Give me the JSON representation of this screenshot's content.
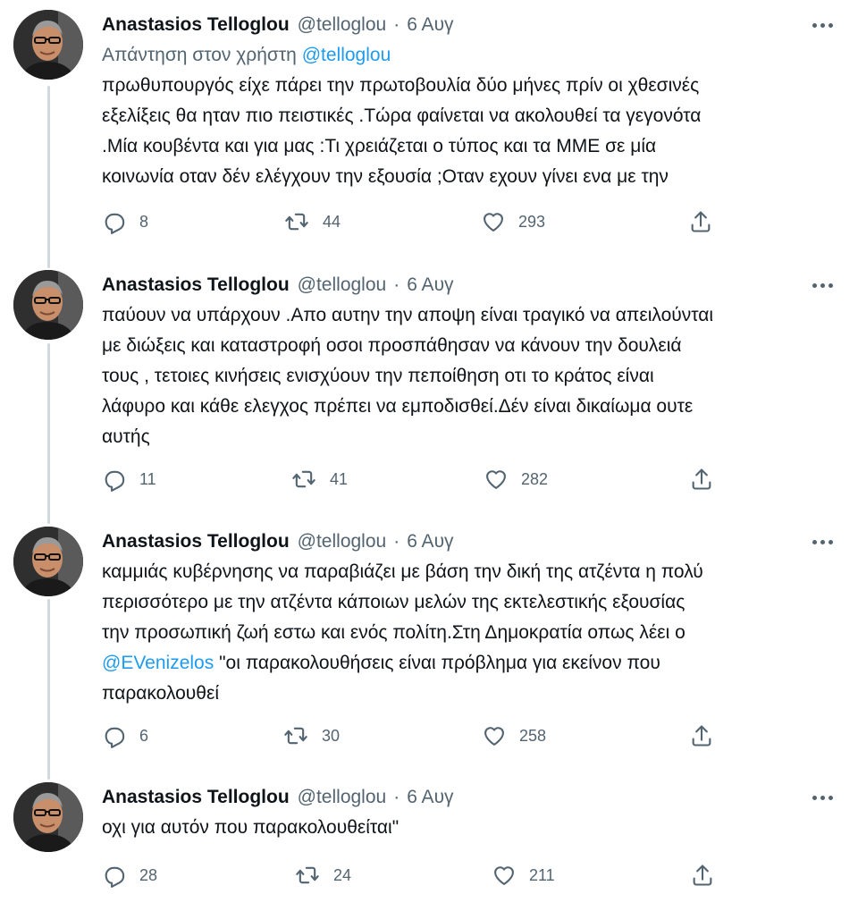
{
  "tweets": [
    {
      "author": "Anastasios Telloglou",
      "handle": "@telloglou",
      "separator": "·",
      "time": "6 Αυγ",
      "reply_prefix": "Απάντηση στον χρήστη",
      "reply_to": "@telloglou",
      "lines": [
        "πρωθυπουργός είχε πάρει την πρωτοβουλία δύο μήνες πρίν οι χθεσινές",
        "εξελίξεις θα ηταν πιο πειστικές .Τώρα φαίνεται να ακολουθεί τα γεγονότα",
        ".Μία κουβέντα και για μας :Τι χρειάζεται ο τύπος και τα ΜΜΕ σε μία",
        "κοινωνία οταν δέν ελέγχουν την εξουσία ;Οταν εχουν γίνει ενα με την"
      ],
      "replies": "8",
      "retweets": "44",
      "likes": "293"
    },
    {
      "author": "Anastasios Telloglou",
      "handle": "@telloglou",
      "separator": "·",
      "time": "6 Αυγ",
      "lines": [
        "παύουν να υπάρχουν .Απο αυτην την αποψη είναι τραγικό να απειλούνται",
        "με διώξεις και καταστροφή οσοι προσπάθησαν να κάνουν την δουλειά",
        "τους , τετοιες κινήσεις ενισχύουν την πεποίθηση οτι το κράτος είναι",
        "λάφυρο και κάθε ελεγχος πρέπει να εμποδισθεί.Δέν είναι δικαίωμα ουτε",
        "αυτής"
      ],
      "replies": "11",
      "retweets": "41",
      "likes": "282"
    },
    {
      "author": "Anastasios Telloglou",
      "handle": "@telloglou",
      "separator": "·",
      "time": "6 Αυγ",
      "lines": [
        "καμμιάς κυβέρνησης να παραβιάζει με βάση την δική της ατζέντα η πολύ",
        "περισσότερο με την ατζέντα κάποιων μελών της εκτελεστικής εξουσίας",
        "την προσωπική ζωή εστω και ενός πολίτη.Στη Δημοκρατία οπως λέει ο"
      ],
      "mention": "@EVenizelos",
      "mention_line_rest": " \"οι παρακολουθήσεις είναι πρόβλημα για εκείνον που",
      "last_line": "παρακολουθεί",
      "replies": "6",
      "retweets": "30",
      "likes": "258"
    },
    {
      "author": "Anastasios Telloglou",
      "handle": "@telloglou",
      "separator": "·",
      "time": "6 Αυγ",
      "lines": [
        "οχι για αυτόν που παρακολουθείται\""
      ],
      "replies": "28",
      "retweets": "24",
      "likes": "211"
    }
  ],
  "icons": {
    "reply": "reply-icon",
    "retweet": "retweet-icon",
    "like": "heart-icon",
    "share": "share-icon",
    "more": "more-icon"
  },
  "colors": {
    "text": "#0f1419",
    "secondary": "#536471",
    "link": "#1d9bf0",
    "thread_line": "#cfd9de"
  }
}
